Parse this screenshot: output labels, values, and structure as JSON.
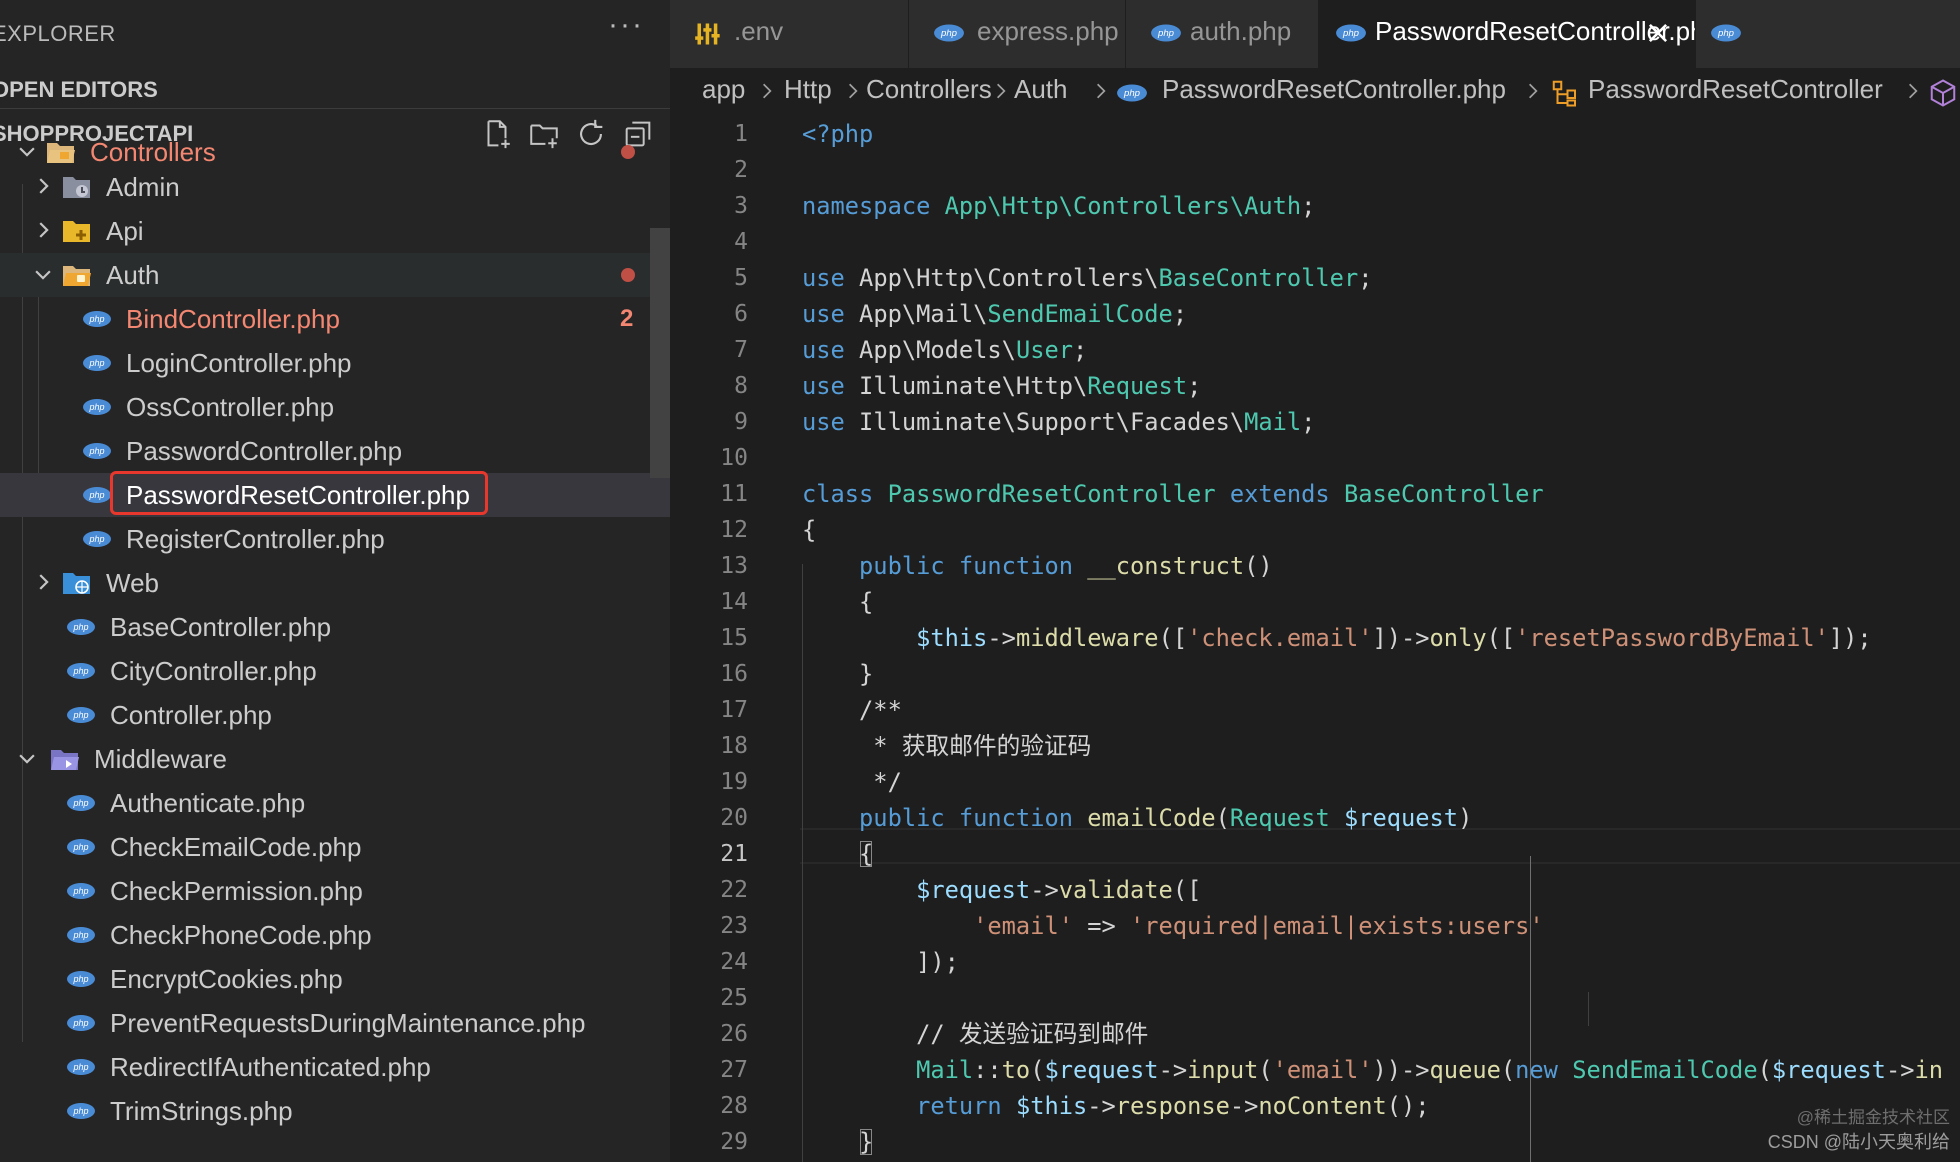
{
  "sidebar": {
    "explorer_title": "EXPLORER",
    "more_actions": "···",
    "open_editors_title": "OPEN EDITORS",
    "project_title": "SHOPPROJECTAPI",
    "tree": [
      {
        "label": "Controllers",
        "modified": true,
        "dot": true
      },
      {
        "label": "Admin"
      },
      {
        "label": "Api"
      },
      {
        "label": "Auth",
        "dot": true
      },
      {
        "label": "BindController.php",
        "modified": true,
        "badge": "2"
      },
      {
        "label": "LoginController.php"
      },
      {
        "label": "OssController.php"
      },
      {
        "label": "PasswordController.php"
      },
      {
        "label": "PasswordResetController.php",
        "selected": true
      },
      {
        "label": "RegisterController.php"
      },
      {
        "label": "Web"
      },
      {
        "label": "BaseController.php"
      },
      {
        "label": "CityController.php"
      },
      {
        "label": "Controller.php"
      },
      {
        "label": "Middleware"
      },
      {
        "label": "Authenticate.php"
      },
      {
        "label": "CheckEmailCode.php"
      },
      {
        "label": "CheckPermission.php"
      },
      {
        "label": "CheckPhoneCode.php"
      },
      {
        "label": "EncryptCookies.php"
      },
      {
        "label": "PreventRequestsDuringMaintenance.php"
      },
      {
        "label": "RedirectIfAuthenticated.php"
      },
      {
        "label": "TrimStrings.php"
      }
    ]
  },
  "tabs": [
    {
      "label": ".env"
    },
    {
      "label": "express.php"
    },
    {
      "label": "auth.php"
    },
    {
      "label": "PasswordResetController.php",
      "active": true
    }
  ],
  "breadcrumb": [
    "app",
    "Http",
    "Controllers",
    "Auth",
    "PasswordResetController.php",
    "PasswordResetController"
  ],
  "editor": {
    "current_line": 21,
    "lines": [
      {
        "n": "1",
        "code": "<?php"
      },
      {
        "n": "2",
        "code": ""
      },
      {
        "n": "3",
        "code": "namespace App\\Http\\Controllers\\Auth;"
      },
      {
        "n": "4",
        "code": ""
      },
      {
        "n": "5",
        "code": "use App\\Http\\Controllers\\BaseController;"
      },
      {
        "n": "6",
        "code": "use App\\Mail\\SendEmailCode;"
      },
      {
        "n": "7",
        "code": "use App\\Models\\User;"
      },
      {
        "n": "8",
        "code": "use Illuminate\\Http\\Request;"
      },
      {
        "n": "9",
        "code": "use Illuminate\\Support\\Facades\\Mail;"
      },
      {
        "n": "10",
        "code": ""
      },
      {
        "n": "11",
        "code": "class PasswordResetController extends BaseController"
      },
      {
        "n": "12",
        "code": "{"
      },
      {
        "n": "13",
        "code": "    public function __construct()"
      },
      {
        "n": "14",
        "code": "    {"
      },
      {
        "n": "15",
        "code": "        $this->middleware(['check.email'])->only(['resetPasswordByEmail']);"
      },
      {
        "n": "16",
        "code": "    }"
      },
      {
        "n": "17",
        "code": "    /**"
      },
      {
        "n": "18",
        "code": "     * 获取邮件的验证码"
      },
      {
        "n": "19",
        "code": "     */"
      },
      {
        "n": "20",
        "code": "    public function emailCode(Request $request)"
      },
      {
        "n": "21",
        "code": "    {"
      },
      {
        "n": "22",
        "code": "        $request->validate(["
      },
      {
        "n": "23",
        "code": "            'email' => 'required|email|exists:users'"
      },
      {
        "n": "24",
        "code": "        ]);"
      },
      {
        "n": "25",
        "code": ""
      },
      {
        "n": "26",
        "code": "        // 发送验证码到邮件"
      },
      {
        "n": "27",
        "code": "        Mail::to($request->input('email'))->queue(new SendEmailCode($request->in"
      },
      {
        "n": "28",
        "code": "        return $this->response->noContent();"
      },
      {
        "n": "29",
        "code": "    }"
      }
    ]
  },
  "watermark": {
    "line1": "@稀土掘金技术社区",
    "line2": "CSDN @陆小天奥利给"
  },
  "colors": {
    "accent_red": "#e8372c",
    "modified_file": "#f48771",
    "php_icon": "#4a8bd6",
    "folder": "#dcb67a"
  }
}
